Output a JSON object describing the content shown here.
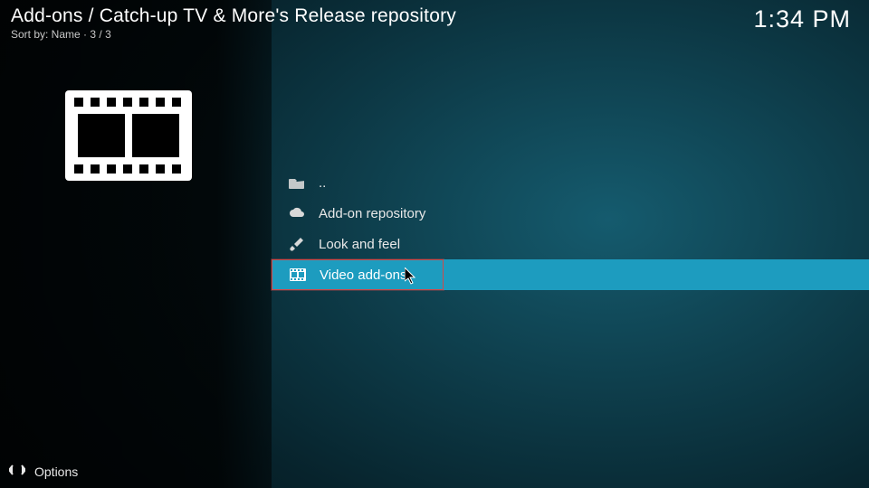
{
  "header": {
    "breadcrumb": "Add-ons / Catch-up TV & More's Release repository",
    "sort_label": "Sort by: Name",
    "count": "3 / 3"
  },
  "clock": "1:34 PM",
  "list": {
    "parent_label": "..",
    "items": [
      {
        "icon": "cloud-icon",
        "label": "Add-on repository"
      },
      {
        "icon": "brush-icon",
        "label": "Look and feel"
      },
      {
        "icon": "film-icon",
        "label": "Video add-ons"
      }
    ],
    "selected_index": 2
  },
  "footer": {
    "options_label": "Options"
  }
}
